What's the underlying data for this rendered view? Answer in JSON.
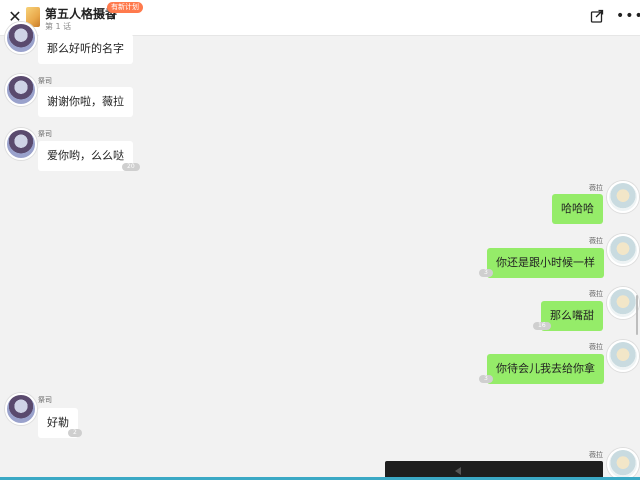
{
  "header": {
    "close_icon": "close-icon",
    "title": "第五人格摄香",
    "subtitle": "第 1 话",
    "badge": "有新计划",
    "chevron": "›",
    "share_icon": "share-icon",
    "more_icon": "more-icon"
  },
  "messages": [
    {
      "id": "m0",
      "side": "left",
      "name": "",
      "text": "那么好听的名字",
      "count": ""
    },
    {
      "id": "m1",
      "side": "left",
      "name": "祭司",
      "text": "谢谢你啦，薇拉",
      "count": ""
    },
    {
      "id": "m2",
      "side": "left",
      "name": "祭司",
      "text": "爱你哟，么么哒",
      "count": "20"
    },
    {
      "id": "m3",
      "side": "right",
      "name": "薇拉",
      "text": "哈哈哈",
      "count": ""
    },
    {
      "id": "m4",
      "side": "right",
      "name": "薇拉",
      "text": "你还是跟小时候一样",
      "count": "3"
    },
    {
      "id": "m5",
      "side": "right",
      "name": "薇拉",
      "text": "那么嘴甜",
      "count": "16"
    },
    {
      "id": "m6",
      "side": "right",
      "name": "薇拉",
      "text": "你待会儿我去给你拿",
      "count": "3"
    },
    {
      "id": "m7",
      "side": "left",
      "name": "祭司",
      "text": "好勒",
      "count": "2"
    },
    {
      "id": "m8",
      "side": "right",
      "name": "薇拉",
      "text": "",
      "count": ""
    }
  ],
  "colors": {
    "accent": "#3ba9c5",
    "bubble_right": "#95ec69",
    "bubble_left": "#ffffff",
    "badge": "#ff7a4d"
  }
}
